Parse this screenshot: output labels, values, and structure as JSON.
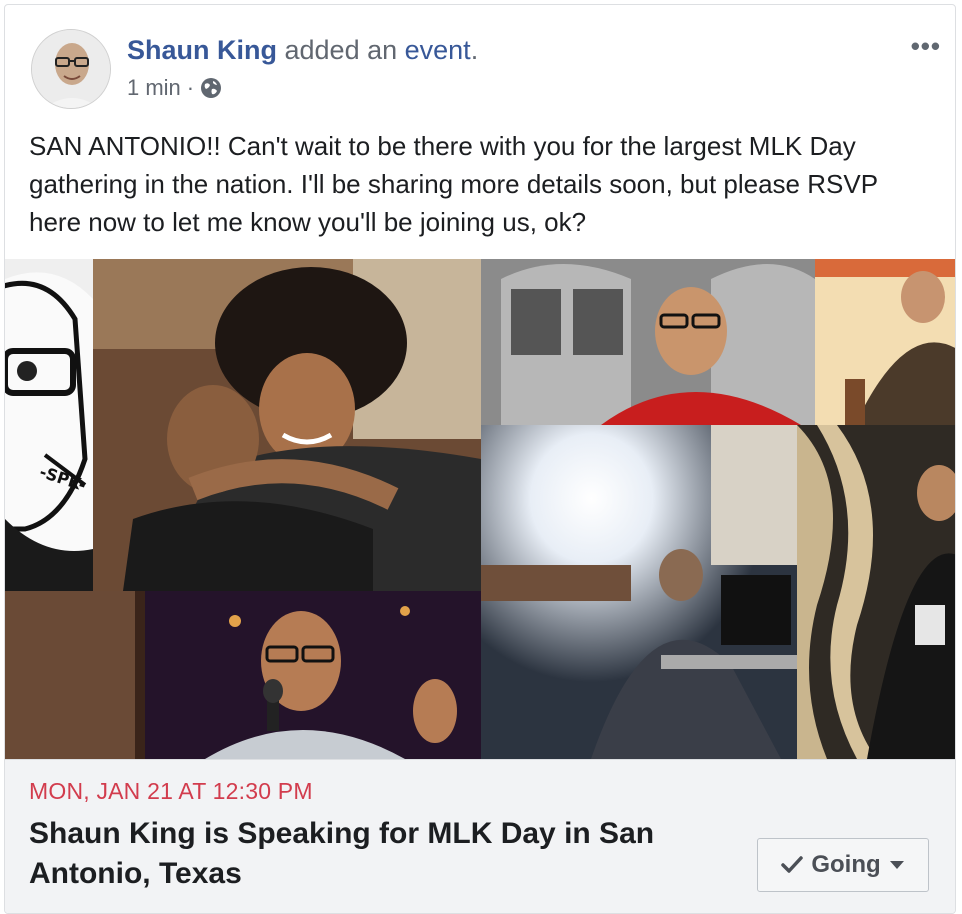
{
  "post": {
    "author": "Shaun King",
    "action_prefix": " added an ",
    "action_link": "event",
    "action_suffix": ".",
    "timestamp": "1 min",
    "separator": "·",
    "privacy_icon": "globe-icon",
    "more_label": "•••",
    "text": "SAN ANTONIO!! Can't wait to be there with you for the largest MLK Day gathering in the nation. I'll be sharing more details soon, but please RSVP here now to let me know you'll be joining us, ok?"
  },
  "event": {
    "date": "MON, JAN 21 AT 12:30 PM",
    "title": "Shaun King is Speaking for MLK Day in San Antonio, Texas",
    "rsvp_label": "Going",
    "rsvp_icon": "check-icon",
    "dropdown_icon": "caret-down-icon"
  },
  "mosaic": {
    "illustration_tag": "-SPK-"
  },
  "colors": {
    "link": "#385898",
    "date": "#d23c4d",
    "footer_bg": "#f2f3f5"
  }
}
